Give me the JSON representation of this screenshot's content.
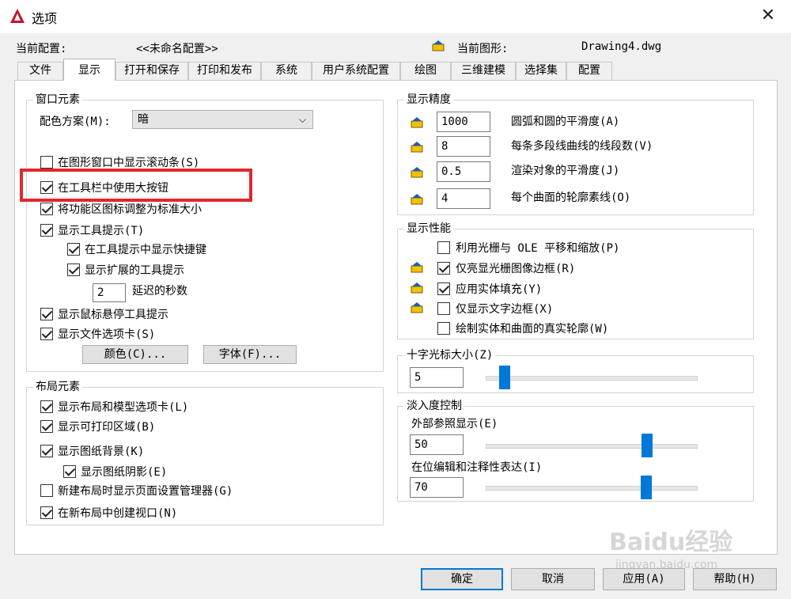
{
  "window": {
    "title": "选项"
  },
  "info": {
    "profile_label": "当前配置:",
    "profile_value": "<<未命名配置>>",
    "drawing_label": "当前图形:",
    "drawing_value": "Drawing4.dwg"
  },
  "tabs": [
    "文件",
    "显示",
    "打开和保存",
    "打印和发布",
    "系统",
    "用户系统配置",
    "绘图",
    "三维建模",
    "选择集",
    "配置"
  ],
  "active_tab": "显示",
  "window_elements": {
    "title": "窗口元素",
    "color_scheme_label": "配色方案(M):",
    "color_scheme_value": "暗",
    "options": [
      {
        "label": "在图形窗口中显示滚动条(S)",
        "checked": false
      },
      {
        "label": "在工具栏中使用大按钮",
        "checked": true
      },
      {
        "label": "将功能区图标调整为标准大小",
        "checked": true
      },
      {
        "label": "显示工具提示(T)",
        "checked": true
      },
      {
        "label": "在工具提示中显示快捷键",
        "checked": true
      },
      {
        "label": "显示扩展的工具提示",
        "checked": true
      },
      {
        "label": "显示鼠标悬停工具提示",
        "checked": true
      },
      {
        "label": "显示文件选项卡(S)",
        "checked": true
      }
    ],
    "delay_value": "2",
    "delay_label": "延迟的秒数",
    "colors_button": "颜色(C)...",
    "fonts_button": "字体(F)..."
  },
  "layout_elements": {
    "title": "布局元素",
    "options": [
      {
        "label": "显示布局和模型选项卡(L)",
        "checked": true
      },
      {
        "label": "显示可打印区域(B)",
        "checked": true
      },
      {
        "label": "显示图纸背景(K)",
        "checked": true
      },
      {
        "label": "显示图纸阴影(E)",
        "checked": true
      },
      {
        "label": "新建布局时显示页面设置管理器(G)",
        "checked": false
      },
      {
        "label": "在新布局中创建视口(N)",
        "checked": true
      }
    ]
  },
  "display_resolution": {
    "title": "显示精度",
    "items": [
      {
        "value": "1000",
        "label": "圆弧和圆的平滑度(A)"
      },
      {
        "value": "8",
        "label": "每条多段线曲线的线段数(V)"
      },
      {
        "value": "0.5",
        "label": "渲染对象的平滑度(J)"
      },
      {
        "value": "4",
        "label": "每个曲面的轮廓素线(O)"
      }
    ]
  },
  "display_performance": {
    "title": "显示性能",
    "options": [
      {
        "label": "利用光栅与 OLE 平移和缩放(P)",
        "checked": false
      },
      {
        "label": "仅亮显光栅图像边框(R)",
        "checked": true
      },
      {
        "label": "应用实体填充(Y)",
        "checked": true
      },
      {
        "label": "仅显示文字边框(X)",
        "checked": false
      },
      {
        "label": "绘制实体和曲面的真实轮廓(W)",
        "checked": false
      }
    ]
  },
  "crosshair": {
    "title": "十字光标大小(Z)",
    "value": "5",
    "fraction": 0.05
  },
  "fade": {
    "title": "淡入度控制",
    "xref_label": "外部参照显示(E)",
    "xref_value": "50",
    "xref_fraction": 0.5,
    "inplace_label": "在位编辑和注释性表达(I)",
    "inplace_value": "70",
    "inplace_fraction": 0.7
  },
  "buttons": {
    "ok": "确定",
    "cancel": "取消",
    "apply": "应用(A)",
    "help": "帮助(H)"
  },
  "watermark": {
    "brand": "Baidu经验",
    "url": "jingyan.baidu.com"
  },
  "colors": {
    "accent": "#0078d7",
    "highlight": "#e3262b",
    "app_icon": "#c8102e"
  },
  "icons": {
    "app": "autocad-icon",
    "close": "close-icon",
    "drawing": "drawing-pref-icon"
  }
}
